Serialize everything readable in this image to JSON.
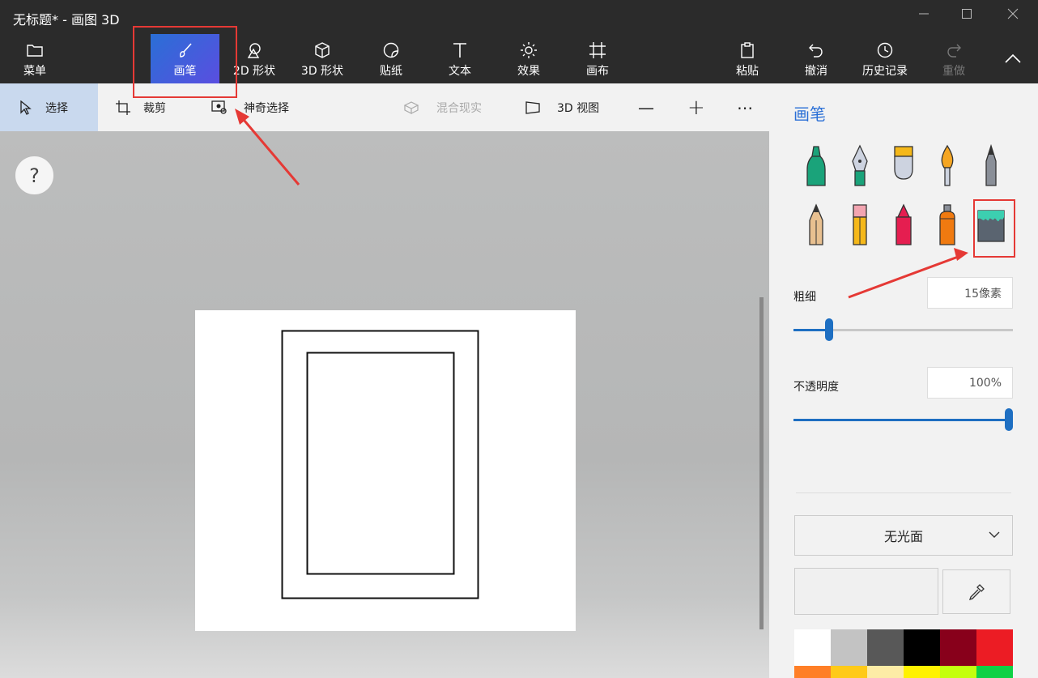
{
  "window": {
    "title": "无标题* - 画图 3D"
  },
  "ribbon": {
    "menu_label": "菜单",
    "brushes_label": "画笔",
    "shapes2d_label": "2D 形状",
    "shapes3d_label": "3D 形状",
    "stickers_label": "贴纸",
    "text_label": "文本",
    "effects_label": "效果",
    "canvas_label": "画布",
    "paste_label": "粘贴",
    "undo_label": "撤消",
    "history_label": "历史记录",
    "redo_label": "重做",
    "active_tab": "画笔"
  },
  "toolbar": {
    "select_label": "选择",
    "crop_label": "裁剪",
    "magic_select_label": "神奇选择",
    "mixed_reality_label": "混合现实",
    "view3d_label": "3D 视图",
    "zoom_out": "—",
    "zoom_in": "+",
    "more": "⋯"
  },
  "canvas": {
    "help_label": "?"
  },
  "panel": {
    "title": "画笔",
    "brushes": [
      {
        "name": "marker",
        "color": "#1aa37a"
      },
      {
        "name": "calligraphy-pen",
        "color": "#444"
      },
      {
        "name": "oil-brush",
        "color": "#f5b81a"
      },
      {
        "name": "watercolor",
        "color": "#f0a020"
      },
      {
        "name": "pixel-pen",
        "color": "#777"
      },
      {
        "name": "pencil",
        "color": "#d9a35a"
      },
      {
        "name": "eraser",
        "color": "#f3a5b1"
      },
      {
        "name": "crayon",
        "color": "#e51e50"
      },
      {
        "name": "spray-can",
        "color": "#f07a10"
      },
      {
        "name": "fill",
        "color": "#3ccfb0"
      }
    ],
    "selected_brush": "fill",
    "thickness_label": "粗细",
    "thickness_value": "15像素",
    "thickness_fraction": 0.15,
    "opacity_label": "不透明度",
    "opacity_value": "100%",
    "opacity_fraction": 1.0,
    "material_label": "无光面",
    "palette": [
      "#ffffff",
      "#c3c3c3",
      "#585858",
      "#000000",
      "#88001b",
      "#ec1c24",
      "#ff7f27",
      "#ffca18",
      "#fdeca6",
      "#fff200",
      "#c4ff0e",
      "#0ed145"
    ]
  },
  "colors": {
    "accent": "#2a6fd6",
    "annotation": "#e53935",
    "slider": "#1e6fc2"
  }
}
